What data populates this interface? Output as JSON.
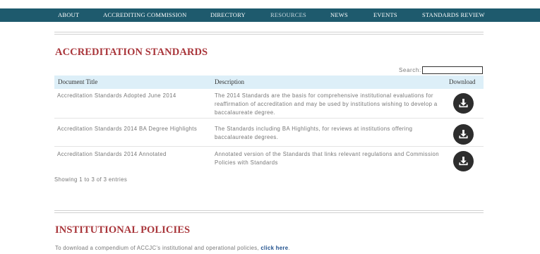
{
  "nav": {
    "items": [
      "ABOUT",
      "ACCREDITING COMMISSION",
      "DIRECTORY",
      "RESOURCES",
      "NEWS",
      "EVENTS",
      "STANDARDS REVIEW"
    ]
  },
  "accreditation": {
    "title": "ACCREDITATION STANDARDS",
    "search_label": "Search:",
    "search_value": "",
    "columns": [
      "Document Title",
      "Description",
      "Download"
    ],
    "rows": [
      {
        "title": "Accreditation Standards Adopted June 2014",
        "description": "The 2014 Standards are the basis for comprehensive institutional evaluations for reaffirmation of accreditation and may be used by institutions wishing to develop a baccalaureate degree.",
        "download_icon": "download-icon"
      },
      {
        "title": "Accreditation Standards 2014 BA Degree Highlights",
        "description": "The Standards including BA Highlights, for reviews at institutions offering baccalaureate degrees.",
        "download_icon": "download-icon"
      },
      {
        "title": "Accreditation Standards 2014 Annotated",
        "description": "Annotated version of the Standards that links relevant regulations and Commission Policies with Standards",
        "download_icon": "download-icon"
      }
    ],
    "entries_info": "Showing 1 to 3 of 3 entries"
  },
  "policies": {
    "title": "INSTITUTIONAL POLICIES",
    "text": "To download a compendium of ACCJC’s institutional and operational policies,",
    "link": "click here",
    "suffix": "."
  },
  "colors": {
    "nav_bg": "#1e5a6d",
    "heading": "#a9363b",
    "table_header_bg": "#ddeff8",
    "link": "#1e4f8c",
    "button_bg": "#2d2d2d"
  }
}
